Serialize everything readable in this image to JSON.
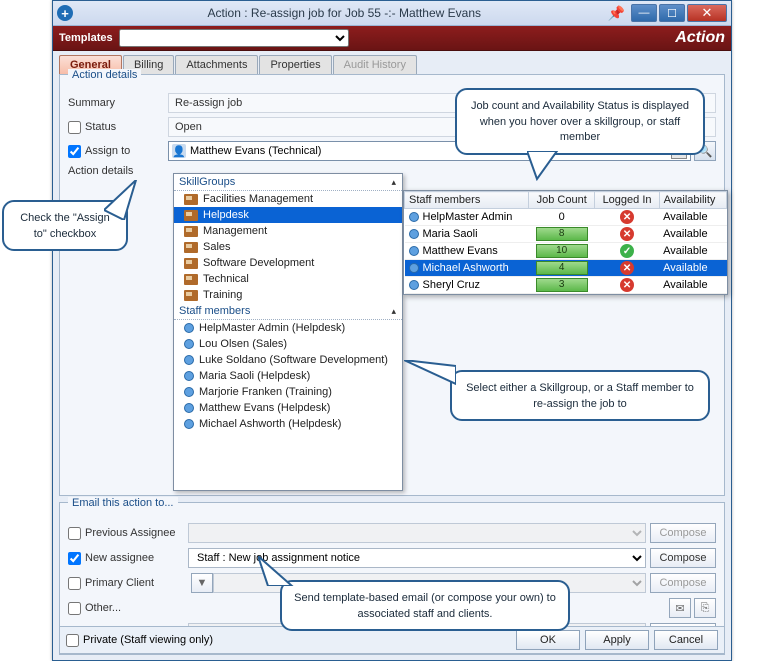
{
  "window": {
    "title": "Action : Re-assign job for Job 55 -:- Matthew Evans"
  },
  "templates": {
    "label": "Templates",
    "right_label": "Action"
  },
  "tabs": {
    "general": "General",
    "billing": "Billing",
    "attachments": "Attachments",
    "properties": "Properties",
    "audit": "Audit History",
    "active": "general"
  },
  "action_details": {
    "group_title": "Action details",
    "summary_label": "Summary",
    "summary_value": "Re-assign job",
    "status_label": "Status",
    "status_checked": false,
    "status_value": "Open",
    "assign_label": "Assign to",
    "assign_checked": true,
    "assign_value": "Matthew Evans (Technical)",
    "details_label": "Action details"
  },
  "skillgroups": {
    "header": "SkillGroups",
    "items": [
      "Facilities Management",
      "Helpdesk",
      "Management",
      "Sales",
      "Software Development",
      "Technical",
      "Training"
    ],
    "selected": "Helpdesk"
  },
  "staff_members": {
    "header": "Staff members",
    "items": [
      "HelpMaster Admin  (Helpdesk)",
      "Lou Olsen  (Sales)",
      "Luke Soldano  (Software Development)",
      "Maria Saoli  (Helpdesk)",
      "Marjorie Franken  (Training)",
      "Matthew Evans  (Helpdesk)",
      "Michael Ashworth  (Helpdesk)"
    ]
  },
  "flyout": {
    "columns": [
      "Staff members",
      "Job Count",
      "Logged In",
      "Availability"
    ],
    "rows": [
      {
        "name": "HelpMaster Admin",
        "count": "0",
        "badge": false,
        "logged": false,
        "avail": "Available"
      },
      {
        "name": "Maria Saoli",
        "count": "8",
        "badge": true,
        "logged": false,
        "avail": "Available"
      },
      {
        "name": "Matthew Evans",
        "count": "10",
        "badge": true,
        "logged": true,
        "avail": "Available"
      },
      {
        "name": "Michael Ashworth",
        "count": "4",
        "badge": true,
        "logged": false,
        "avail": "Available",
        "selected": true
      },
      {
        "name": "Sheryl Cruz",
        "count": "3",
        "badge": true,
        "logged": false,
        "avail": "Available"
      }
    ]
  },
  "email": {
    "group_title": "Email this action to...",
    "prev_label": "Previous Assignee",
    "new_label": "New assignee",
    "new_value": "Staff : New job assignment notice",
    "primary_label": "Primary Client",
    "other_label": "Other...",
    "compose": "Compose"
  },
  "footer": {
    "private_label": "Private (Staff viewing only)",
    "ok": "OK",
    "apply": "Apply",
    "cancel": "Cancel"
  },
  "callouts": {
    "c1": "Job count and Availability Status is displayed when you hover over a skillgroup, or staff member",
    "c2": "Check the \"Assign to\" checkbox",
    "c3": "Select either a Skillgroup, or a Staff member to re-assign the job to",
    "c4": "Send template-based email (or compose your own) to associated staff and clients."
  }
}
